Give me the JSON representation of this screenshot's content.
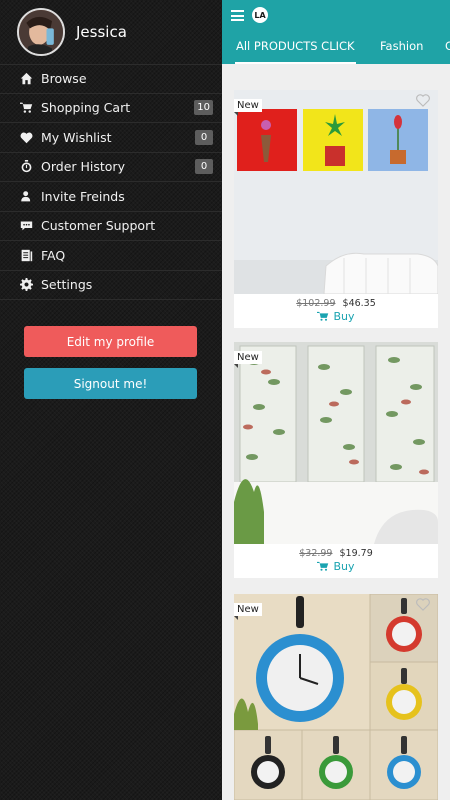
{
  "user": {
    "name": "Jessica"
  },
  "menu": {
    "items": [
      {
        "label": "Browse",
        "icon": "home-icon"
      },
      {
        "label": "Shopping Cart",
        "icon": "cart-icon",
        "badge": "10"
      },
      {
        "label": "My Wishlist",
        "icon": "heart-icon",
        "badge": "0"
      },
      {
        "label": "Order History",
        "icon": "stopwatch-icon",
        "badge": "0"
      },
      {
        "label": "Invite Freinds",
        "icon": "user-plus-icon"
      },
      {
        "label": "Customer Support",
        "icon": "chat-icon"
      },
      {
        "label": "FAQ",
        "icon": "document-icon"
      },
      {
        "label": "Settings",
        "icon": "gear-icon"
      }
    ]
  },
  "buttons": {
    "edit_profile": "Edit my profile",
    "signout": "Signout me!"
  },
  "header": {
    "logo_text": "LA",
    "tabs": [
      {
        "label": "All PRODUCTS CLICK"
      },
      {
        "label": "Fashion"
      },
      {
        "label": "C"
      }
    ]
  },
  "products": [
    {
      "tag": "New",
      "old_price": "$102.99",
      "price": "$46.35",
      "buy": "Buy"
    },
    {
      "tag": "New",
      "old_price": "$32.99",
      "price": "$19.79",
      "buy": "Buy"
    },
    {
      "tag": "New"
    }
  ],
  "colors": {
    "topbar": "#1fa3a6",
    "edit_button": "#ef5b5b",
    "signout_button": "#2b9db8",
    "drawer_bg": "#1b1b1b"
  }
}
